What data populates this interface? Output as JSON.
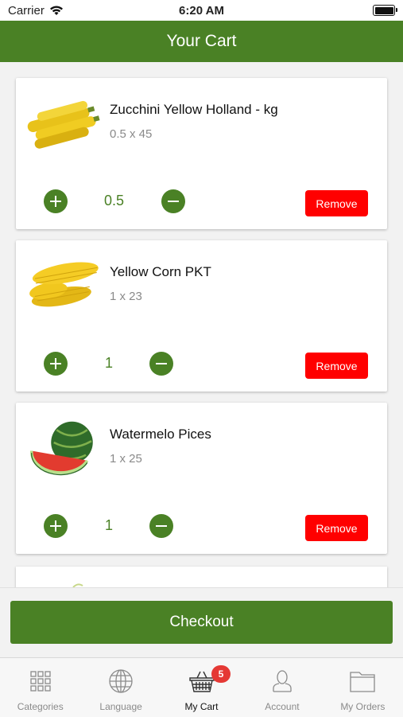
{
  "status_bar": {
    "carrier": "Carrier",
    "time": "6:20 AM"
  },
  "header": {
    "title": "Your Cart"
  },
  "cart_items": [
    {
      "name": "Zucchini Yellow Holland - kg",
      "detail": "0.5 x 45",
      "quantity": "0.5",
      "remove_label": "Remove",
      "image": "zucchini-image"
    },
    {
      "name": "Yellow Corn PKT",
      "detail": "1 x 23",
      "quantity": "1",
      "remove_label": "Remove",
      "image": "corn-image"
    },
    {
      "name": "Watermelo Pices",
      "detail": "1 x 25",
      "quantity": "1",
      "remove_label": "Remove",
      "image": "watermelon-image"
    }
  ],
  "checkout": {
    "label": "Checkout"
  },
  "tabbar": {
    "items": [
      {
        "label": "Categories",
        "icon": "grid-icon"
      },
      {
        "label": "Language",
        "icon": "globe-icon"
      },
      {
        "label": "My Cart",
        "icon": "basket-icon",
        "active": true
      },
      {
        "label": "Account",
        "icon": "person-icon"
      },
      {
        "label": "My Orders",
        "icon": "folder-icon"
      }
    ],
    "cart_badge": "5"
  },
  "colors": {
    "brand_green": "#4a8125",
    "remove_red": "#ff0000",
    "badge_red": "#e53935"
  }
}
